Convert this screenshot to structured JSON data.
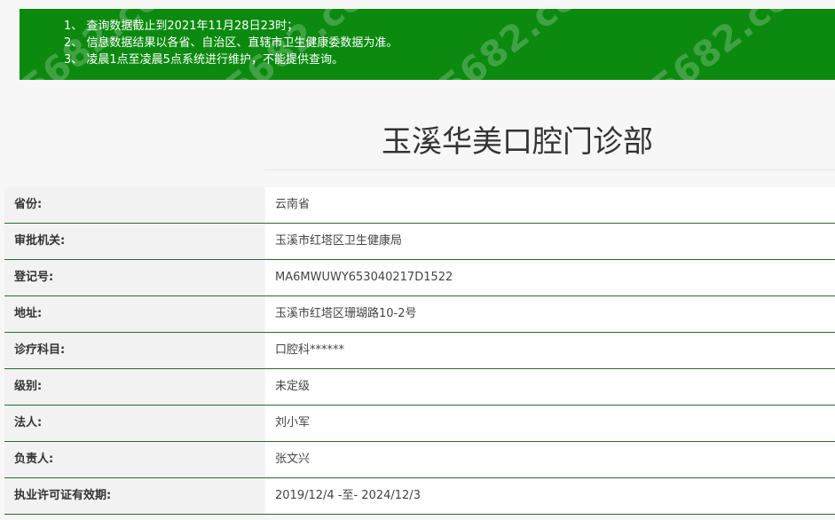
{
  "notice": {
    "lines": [
      "1、 查询数据截止到2021年11月28日23时；",
      "2、 信息数据结果以各省、自治区、直辖市卫生健康委数据为准。",
      "3、 凌晨1点至凌晨5点系统进行维护，不能提供查询。"
    ],
    "watermark": "5682.cc",
    "color": "#0b8a0f"
  },
  "title": "玉溪华美口腔门诊部",
  "rows": [
    {
      "label": "省份:",
      "value": "云南省"
    },
    {
      "label": "审批机关:",
      "value": "玉溪市红塔区卫生健康局"
    },
    {
      "label": "登记号:",
      "value": "MA6MWUWY653040217D1522"
    },
    {
      "label": "地址:",
      "value": "玉溪市红塔区珊瑚路10-2号"
    },
    {
      "label": "诊疗科目:",
      "value": "口腔科******"
    },
    {
      "label": "级别:",
      "value": "未定级"
    },
    {
      "label": "法人:",
      "value": "刘小军"
    },
    {
      "label": "负责人:",
      "value": "张文兴"
    },
    {
      "label": "执业许可证有效期:",
      "value": "2019/12/4 -至- 2024/12/3"
    }
  ]
}
